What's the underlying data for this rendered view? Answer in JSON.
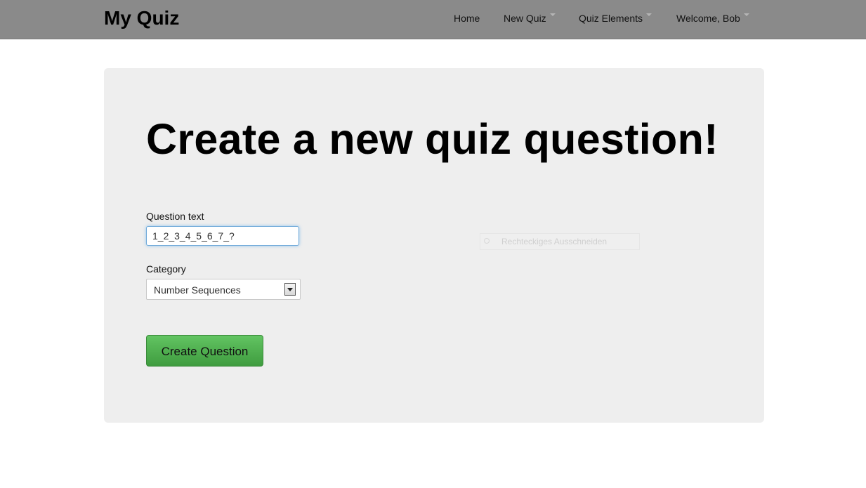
{
  "navbar": {
    "brand": "My Quiz",
    "items": [
      {
        "label": "Home",
        "dropdown": false
      },
      {
        "label": "New Quiz",
        "dropdown": true
      },
      {
        "label": "Quiz Elements",
        "dropdown": true
      },
      {
        "label": "Welcome, Bob",
        "dropdown": true
      }
    ]
  },
  "main": {
    "heading": "Create a new quiz question!",
    "question_label": "Question text",
    "question_value": "1_2_3_4_5_6_7_?",
    "category_label": "Category",
    "category_selected": "Number Sequences",
    "submit_label": "Create Question"
  },
  "overlay": {
    "context_menu_item": "Rechteckiges Ausschneiden"
  },
  "colors": {
    "navbar_bg": "#8a8a8a",
    "hero_bg": "#eeeeee",
    "button_green": "#51a351",
    "focus_border": "#6fa9d9"
  }
}
